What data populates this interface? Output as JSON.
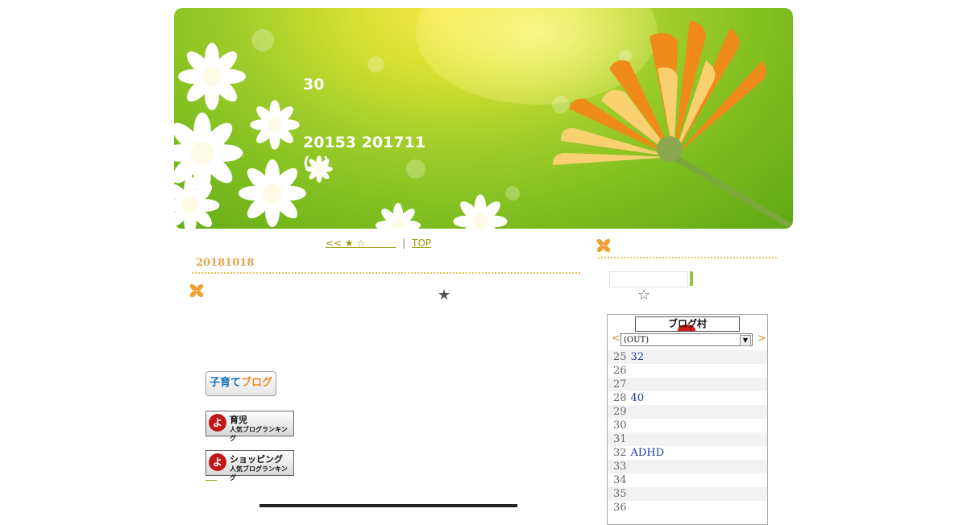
{
  "header": {
    "title": "30",
    "subtitle_line1": "20153  201711",
    "subtitle_line2": "(~)"
  },
  "nav": {
    "prev_label": "<< ★  ☆",
    "separator": "|",
    "top_label": "TOP"
  },
  "post": {
    "date": "20181018",
    "star": "★"
  },
  "badges": {
    "kosodate_a": "子育て",
    "kosodate_b": "ブログ",
    "ikuji_title": "育児",
    "ikuji_sub": "人気ブログランキング",
    "shopping_title": "ショッピング",
    "shopping_sub": "人気ブログランキング",
    "logo_glyph": "よ"
  },
  "sidebar": {
    "star": "☆",
    "search_value": "",
    "ranking": {
      "logo_text": "ブログ村",
      "prev_arrow": "<",
      "next_arrow": ">",
      "selected_option": "(OUT)",
      "rows": [
        {
          "rank": "25",
          "label": "32"
        },
        {
          "rank": "26",
          "label": ""
        },
        {
          "rank": "27",
          "label": ""
        },
        {
          "rank": "28",
          "label": "40"
        },
        {
          "rank": "29",
          "label": ""
        },
        {
          "rank": "30",
          "label": ""
        },
        {
          "rank": "31",
          "label": ""
        },
        {
          "rank": "32",
          "label": "ADHD"
        },
        {
          "rank": "33",
          "label": ""
        },
        {
          "rank": "34",
          "label": ""
        },
        {
          "rank": "35",
          "label": ""
        },
        {
          "rank": "36",
          "label": ""
        }
      ]
    }
  },
  "colors": {
    "accent_orange": "#e6a24a",
    "link_olive": "#9a9a00",
    "rank_link": "#1a3c9c"
  }
}
